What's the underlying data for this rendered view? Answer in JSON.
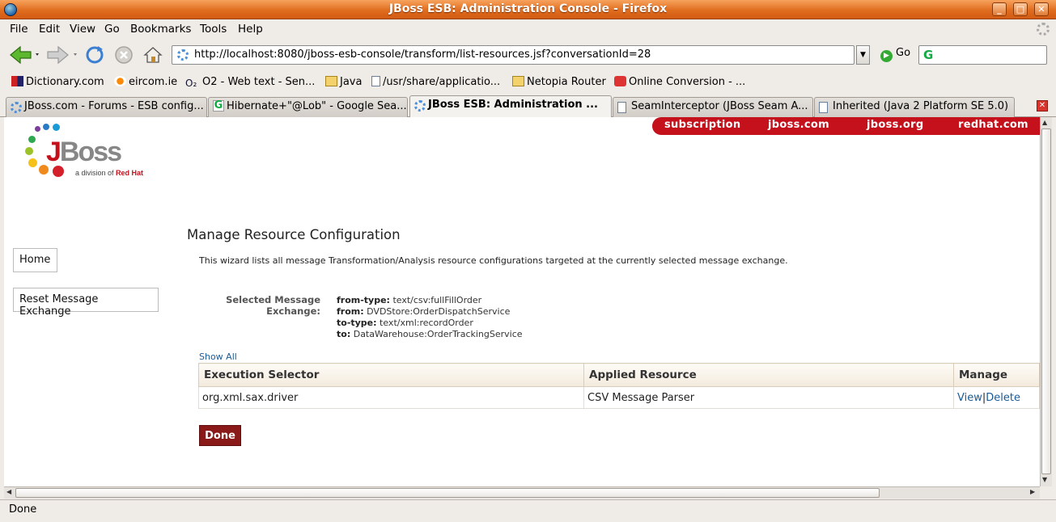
{
  "window": {
    "title": "JBoss ESB: Administration Console - Firefox"
  },
  "menu": [
    "File",
    "Edit",
    "View",
    "Go",
    "Bookmarks",
    "Tools",
    "Help"
  ],
  "nav": {
    "url": "http://localhost:8080/jboss-esb-console/transform/list-resources.jsf?conversationId=28",
    "go_label": "Go",
    "search_value": ""
  },
  "bookmarks": [
    "Dictionary.com",
    "eircom.ie",
    "O2 - Web text - Sen...",
    "Java",
    "/usr/share/applicatio...",
    "Netopia Router",
    "Online Conversion - ..."
  ],
  "tabs": [
    {
      "label": "JBoss.com - Forums - ESB config..."
    },
    {
      "label": "Hibernate+\"@Lob\" - Google Sea..."
    },
    {
      "label": "JBoss ESB: Administration ..."
    },
    {
      "label": "SeamInterceptor (JBoss Seam A..."
    },
    {
      "label": "Inherited (Java 2 Platform SE 5.0)"
    }
  ],
  "page": {
    "toplinks": [
      "subscription",
      "jboss.com",
      "jboss.org",
      "redhat.com"
    ],
    "logo": {
      "word": "JBoss",
      "sub": "a division of",
      "sub_brand": "Red Hat"
    },
    "sidebar": {
      "home": "Home",
      "reset": "Reset Message Exchange"
    },
    "title": "Manage Resource Configuration",
    "intro": "This wizard lists all message Transformation/Analysis resource configurations targeted at the currently selected message exchange.",
    "selected_label": "Selected Message Exchange:",
    "exchange": {
      "from_type_label": "from-type:",
      "from_type": "text/csv:fullFillOrder",
      "from_label": "from:",
      "from": "DVDStore:OrderDispatchService",
      "to_type_label": "to-type:",
      "to_type": "text/xml:recordOrder",
      "to_label": "to:",
      "to": "DataWarehouse:OrderTrackingService"
    },
    "show_all": "Show All",
    "table": {
      "headers": [
        "Execution Selector",
        "Applied Resource",
        "Manage"
      ],
      "rows": [
        {
          "selector": "org.xml.sax.driver",
          "resource": "CSV Message Parser",
          "view": "View",
          "sep": "|",
          "delete": "Delete"
        }
      ]
    },
    "done": "Done"
  },
  "status": "Done"
}
